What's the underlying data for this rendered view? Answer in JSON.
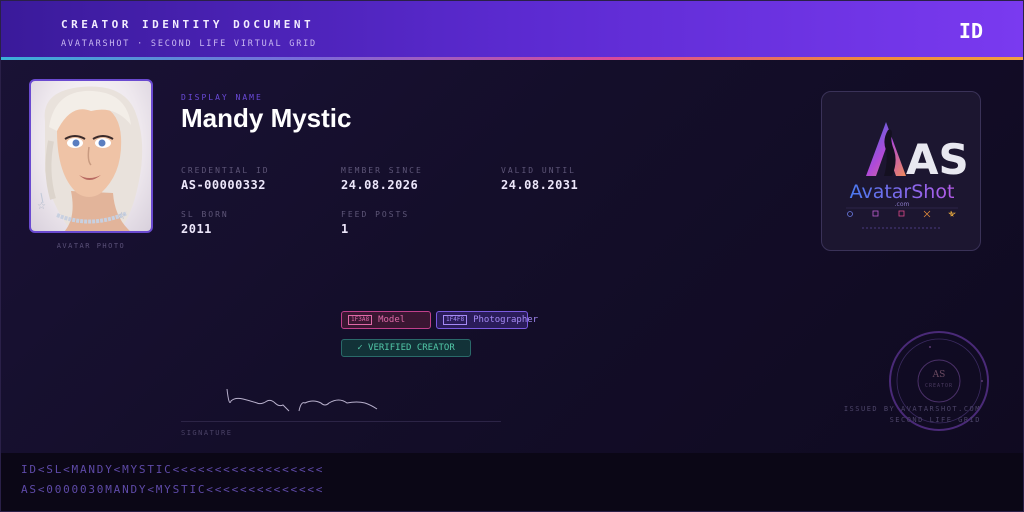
{
  "header": {
    "title": "CREATOR IDENTITY DOCUMENT",
    "subtitle": "AVATARSHOT · SECOND LIFE VIRTUAL GRID",
    "badge": "ID"
  },
  "photo": {
    "caption": "AVATAR PHOTO"
  },
  "identity": {
    "display_name_label": "DISPLAY NAME",
    "display_name": "Mandy Mystic",
    "credential_id_label": "CREDENTIAL ID",
    "credential_id": "AS-00000332",
    "member_since_label": "MEMBER SINCE",
    "member_since": "24.08.2026",
    "valid_until_label": "VALID UNTIL",
    "valid_until": "24.08.2031",
    "sl_born_label": "SL BORN",
    "sl_born": "2011",
    "feed_posts_label": "FEED POSTS",
    "feed_posts": "1"
  },
  "logo": {
    "wordmark_as": "AS",
    "wordmark": "AvatarShot",
    "domain": ".com"
  },
  "tags": [
    {
      "code": "1F3A8",
      "label": "Model",
      "color": "#e06aa8"
    },
    {
      "code": "1F4F8",
      "label": "Photographer",
      "color": "#a58af5"
    }
  ],
  "verified": {
    "label": "✓ VERIFIED CREATOR"
  },
  "signature": {
    "caption": "SIGNATURE"
  },
  "seal": {
    "center": "AS",
    "ring": "CREATOR"
  },
  "issuer": {
    "line1": "ISSUED BY AVATARSHOT.COM",
    "line2": "SECOND LIFE GRID"
  },
  "mrz": {
    "line1": "ID<SL<MANDY<MYSTIC<<<<<<<<<<<<<<<<<<",
    "line2": "AS<0000030MANDY<MYSTIC<<<<<<<<<<<<<<"
  },
  "colors": {
    "header_start": "#3a1a9a",
    "header_end": "#7a3af0",
    "accent": "#6a4ad8",
    "verified": "#52c8a8"
  }
}
